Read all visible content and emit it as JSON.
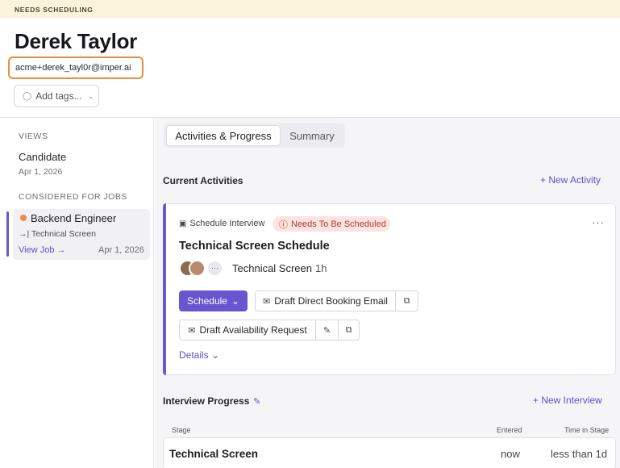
{
  "banner": "NEEDS SCHEDULING",
  "candidate": {
    "name": "Derek Taylor",
    "email": "acme+derek_tayl0r@imper.ai",
    "add_tags_label": "Add tags..."
  },
  "sidebar": {
    "views_heading": "VIEWS",
    "view_item": {
      "label": "Candidate",
      "date": "Apr 1, 2026"
    },
    "jobs_heading": "CONSIDERED FOR JOBS",
    "job": {
      "title": "Backend Engineer",
      "stage": "→| Technical Screen",
      "view_link": "View Job →",
      "date": "Apr 1, 2026",
      "status_color": "#ef8a4b"
    }
  },
  "tabs": [
    {
      "label": "Activities & Progress",
      "active": true
    },
    {
      "label": "Summary",
      "active": false
    }
  ],
  "current_activities": {
    "title": "Current Activities",
    "new_link": "+ New Activity",
    "card": {
      "type_label": "Schedule Interview",
      "status_badge": "Needs To Be Scheduled",
      "more": "···",
      "title": "Technical Screen Schedule",
      "avatars_more": "···",
      "stage_name": "Technical Screen",
      "duration": "1h",
      "schedule_button": "Schedule",
      "draft_email_button": "Draft Direct Booking Email",
      "draft_availability_button": "Draft Availability Request",
      "details_link": "Details"
    }
  },
  "interview_progress": {
    "title": "Interview Progress",
    "new_link": "+ New Interview",
    "columns": {
      "stage": "Stage",
      "entered": "Entered",
      "time_in_stage": "Time in Stage"
    },
    "rows": [
      {
        "stage": "Technical Screen",
        "entered": "now",
        "time_in_stage": "less than 1d"
      }
    ]
  },
  "colors": {
    "accent": "#6a55d0",
    "link": "#5b4fd1",
    "banner_bg": "#fbf3dc",
    "badge_bg": "#fde4df",
    "badge_text": "#b33a2e",
    "email_outline": "#e8913c"
  }
}
